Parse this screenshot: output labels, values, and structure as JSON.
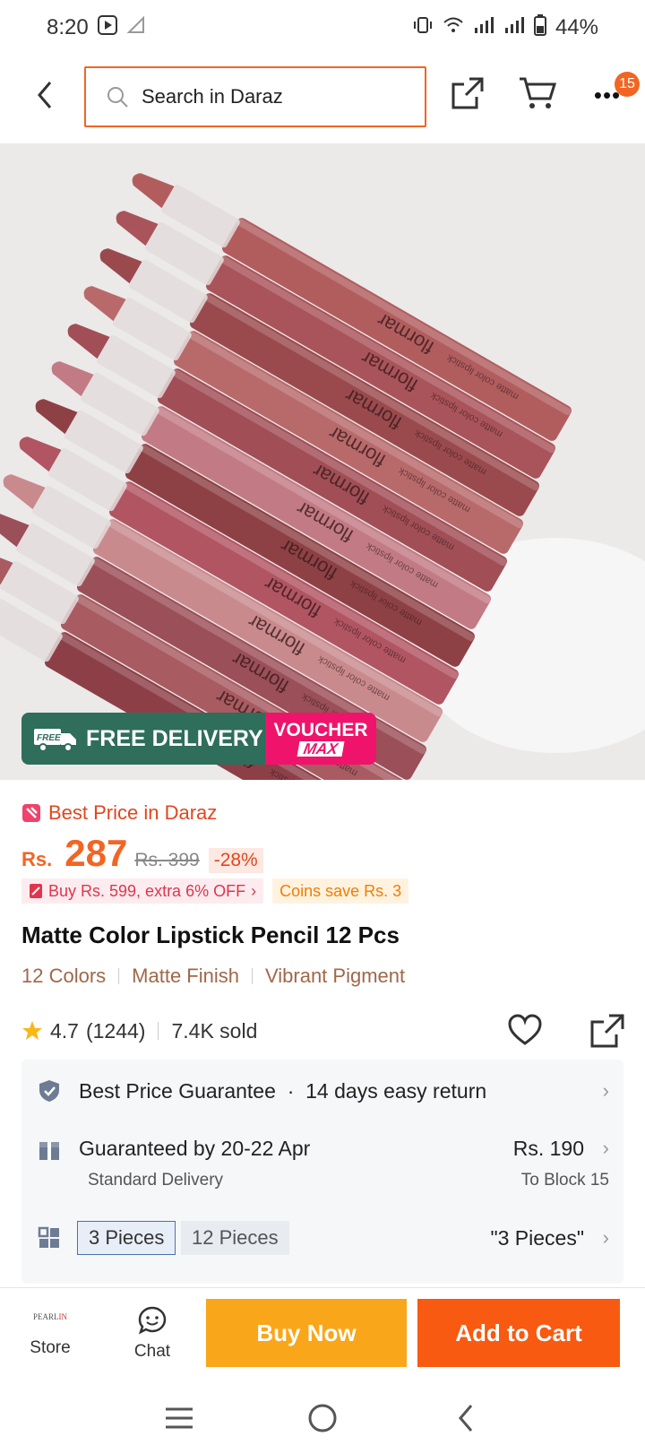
{
  "status_bar": {
    "time": "8:20",
    "battery": "44%"
  },
  "header": {
    "search_placeholder": "Search in Daraz",
    "cart_badge": "15",
    "icons": [
      "back-arrow-icon",
      "search-icon",
      "share-icon",
      "cart-icon",
      "more-icon"
    ]
  },
  "image_badges": {
    "free_tag": "FREE",
    "free_delivery": "FREE DELIVERY",
    "voucher_line1": "VOUCHER",
    "voucher_line2": "MAX"
  },
  "price": {
    "best_price_label": "Best Price in Daraz",
    "currency": "Rs.",
    "current": "287",
    "original": "Rs. 399",
    "discount": "-28%",
    "promo": "Buy Rs. 599, extra 6% OFF",
    "coins": "Coins save Rs. 3"
  },
  "product": {
    "title": "Matte Color Lipstick Pencil 12 Pcs",
    "features": [
      "12 Colors",
      "Matte Finish",
      "Vibrant Pigment"
    ],
    "rating": "4.7",
    "reviews": "(1244)",
    "sold": "7.4K sold"
  },
  "info": {
    "guarantee": "Best Price Guarantee",
    "dot": "·",
    "returns": "14 days easy return",
    "delivery": "Guaranteed by 20-22 Apr",
    "delivery_type": "Standard Delivery",
    "shipping_price": "Rs. 190",
    "shipping_dest": "To Block 15",
    "variants": [
      "3 Pieces",
      "12 Pieces"
    ],
    "selected_variant": "\"3 Pieces\""
  },
  "bottom_bar": {
    "store_logo_a": "PEARL",
    "store_logo_b": "IN",
    "store_label": "Store",
    "chat_label": "Chat",
    "buy_now": "Buy Now",
    "add_to_cart": "Add to Cart"
  },
  "colors": {
    "accent": "#f26522",
    "buy_now": "#f9a61a",
    "add_to_cart": "#f75a10",
    "free_delivery": "#2e6e5a",
    "voucher": "#f0136b"
  },
  "lipsticks": {
    "brand": "flormar",
    "label": "matte color lipstick",
    "shades": [
      "#b15d5e",
      "#a9545a",
      "#9a4a4d",
      "#b86a6b",
      "#a14e56",
      "#c27b84",
      "#8e4145",
      "#b15563",
      "#c98a8e",
      "#9b4f58",
      "#a85b61",
      "#8d3f48"
    ]
  }
}
